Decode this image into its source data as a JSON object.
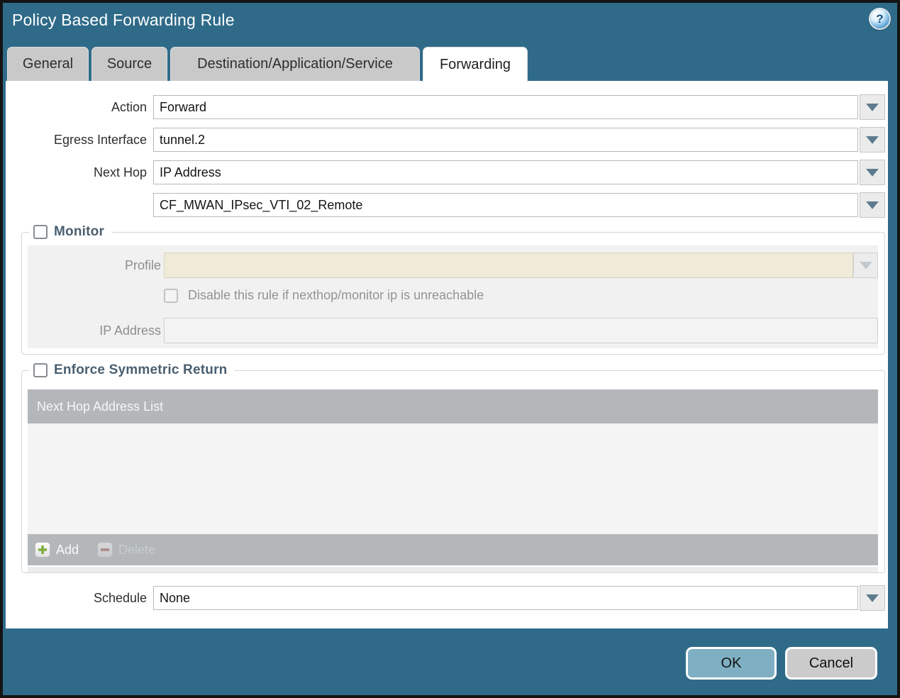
{
  "window": {
    "title": "Policy Based Forwarding Rule",
    "help_glyph": "?"
  },
  "tabs": [
    {
      "label": "General",
      "active": false
    },
    {
      "label": "Source",
      "active": false
    },
    {
      "label": "Destination/Application/Service",
      "active": false
    },
    {
      "label": "Forwarding",
      "active": true
    }
  ],
  "form": {
    "action": {
      "label": "Action",
      "value": "Forward"
    },
    "egress_interface": {
      "label": "Egress Interface",
      "value": "tunnel.2"
    },
    "next_hop": {
      "label": "Next Hop",
      "value": "IP Address"
    },
    "next_hop_address": {
      "value": "CF_MWAN_IPsec_VTI_02_Remote"
    },
    "schedule": {
      "label": "Schedule",
      "value": "None"
    }
  },
  "monitor": {
    "legend": "Monitor",
    "checked": false,
    "profile": {
      "label": "Profile",
      "value": ""
    },
    "disable_rule": {
      "label": "Disable this rule if nexthop/monitor ip is unreachable",
      "checked": false
    },
    "ip_address": {
      "label": "IP Address",
      "value": ""
    }
  },
  "symmetric_return": {
    "legend": "Enforce Symmetric Return",
    "checked": false,
    "table": {
      "header": "Next Hop Address List",
      "rows": []
    },
    "toolbar": {
      "add": "Add",
      "delete": "Delete"
    }
  },
  "buttons": {
    "ok": "OK",
    "cancel": "Cancel"
  },
  "colors": {
    "chrome_teal": "#2f6b89",
    "tab_gray": "#c9c9c9",
    "section_title": "#4a5f70",
    "panel_gray": "#f1f1f1",
    "profile_beige": "#f0ead9",
    "table_header_gray": "#b3b7ba",
    "add_green": "#7fae3f",
    "delete_red": "#a3524c",
    "ok_teal": "#7fafc3",
    "cancel_gray": "#cbcbcb"
  }
}
